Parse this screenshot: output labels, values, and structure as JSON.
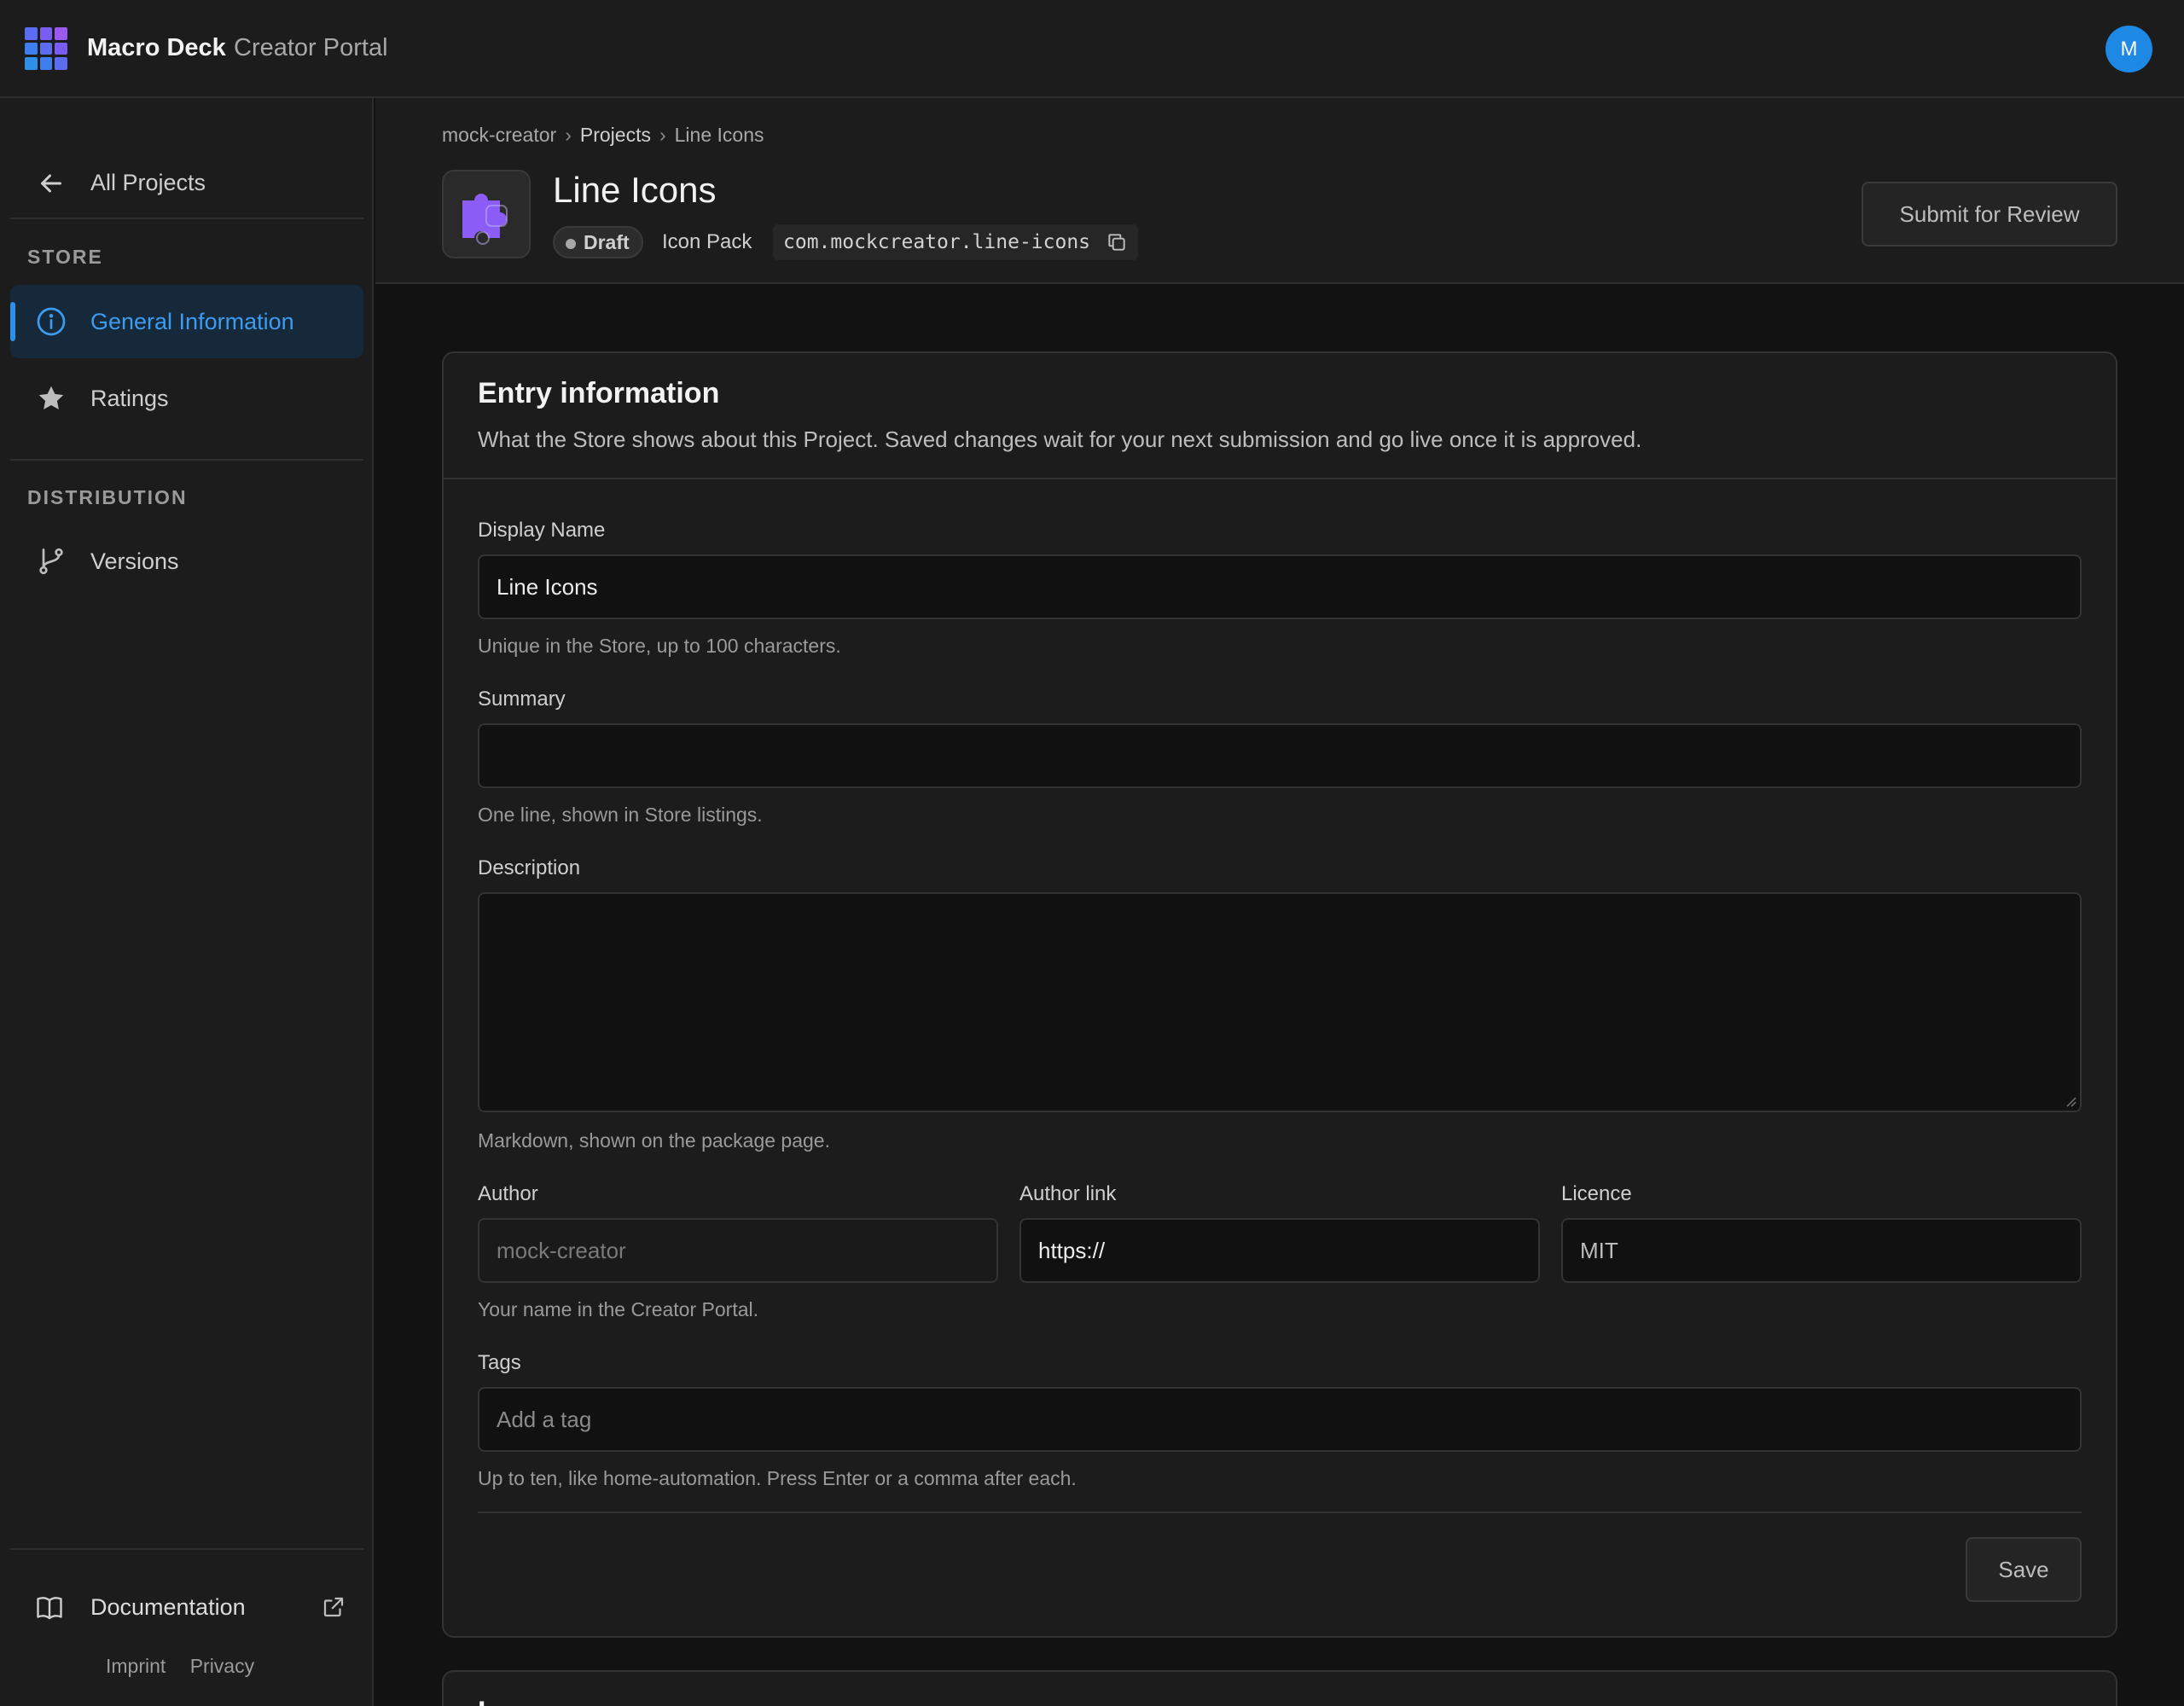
{
  "app": {
    "brand": "Macro Deck",
    "brand_sub": "Creator Portal",
    "avatar_initial": "M",
    "accent": "#2f8fe8"
  },
  "sidebar": {
    "back_label": "All Projects",
    "sections": [
      {
        "label": "STORE",
        "items": [
          {
            "label": "General Information",
            "icon": "info-icon",
            "active": true
          },
          {
            "label": "Ratings",
            "icon": "star-icon",
            "active": false
          }
        ]
      },
      {
        "label": "DISTRIBUTION",
        "items": [
          {
            "label": "Versions",
            "icon": "branch-icon",
            "active": false
          }
        ]
      }
    ],
    "documentation_label": "Documentation",
    "footer_links": [
      "Imprint",
      "Privacy"
    ]
  },
  "header": {
    "breadcrumb": [
      "mock-creator",
      "Projects",
      "Line Icons"
    ],
    "title": "Line Icons",
    "status_badge": "Draft",
    "type": "Icon Pack",
    "package_id": "com.mockcreator.line-icons",
    "submit_label": "Submit for Review"
  },
  "form": {
    "title": "Entry information",
    "description": "What the Store shows about this Project. Saved changes wait for your next submission and go live once it is approved.",
    "display_name": {
      "label": "Display Name",
      "value": "Line Icons",
      "help": "Unique in the Store, up to 100 characters."
    },
    "summary": {
      "label": "Summary",
      "value": "",
      "help": "One line, shown in Store listings."
    },
    "description_field": {
      "label": "Description",
      "value": "",
      "help": "Markdown, shown on the package page."
    },
    "author": {
      "label": "Author",
      "placeholder": "mock-creator",
      "help": "Your name in the Creator Portal."
    },
    "author_link": {
      "label": "Author link",
      "value": "https://"
    },
    "licence": {
      "label": "Licence",
      "value": "MIT"
    },
    "tags": {
      "label": "Tags",
      "placeholder": "Add a tag",
      "help": "Up to ten, like home-automation. Press Enter or a comma after each."
    },
    "save_label": "Save"
  },
  "next_card": {
    "title": "I"
  }
}
